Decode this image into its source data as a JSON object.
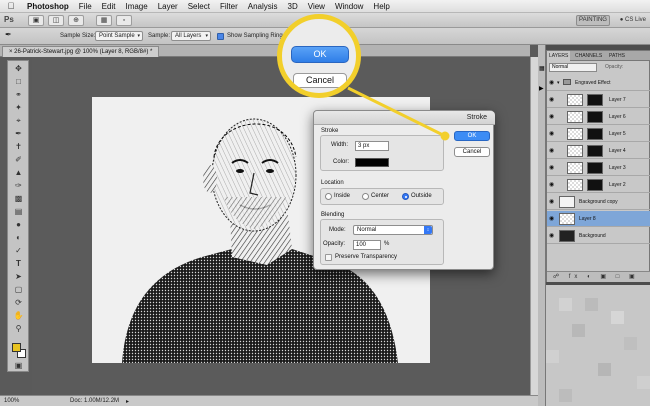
{
  "menubar": {
    "items": [
      "Photoshop",
      "File",
      "Edit",
      "Image",
      "Layer",
      "Select",
      "Filter",
      "Analysis",
      "3D",
      "View",
      "Window",
      "Help"
    ]
  },
  "appbar": {
    "logo": "Ps",
    "workspace": "PAINTING",
    "cs_live": "CS Live"
  },
  "options": {
    "sample_size_label": "Sample Size:",
    "sample_size_value": "Point Sample",
    "sample_label": "Sample:",
    "sample_value": "All Layers",
    "show_ring_label": "Show Sampling Ring"
  },
  "document": {
    "tab_title": "26-Patrick-Stewart.jpg @ 100% (Layer 8, RGB/8#) *",
    "zoom": "100%",
    "doc_size": "Doc: 1.00M/12.2M"
  },
  "colors": {
    "foreground": "#e8c320",
    "accent": "#3c8cf5",
    "callout": "#f2cf2b"
  },
  "layers_panel": {
    "tabs": [
      "LAYERS",
      "CHANNELS",
      "PATHS"
    ],
    "blend_mode": "Normal",
    "opacity_label": "Opacity:",
    "group_name": "Engraved Effect",
    "layers": [
      {
        "name": "Layer 7"
      },
      {
        "name": "Layer 6"
      },
      {
        "name": "Layer 5"
      },
      {
        "name": "Layer 4"
      },
      {
        "name": "Layer 3"
      },
      {
        "name": "Layer 2"
      },
      {
        "name": "Background copy"
      },
      {
        "name": "Layer 8"
      },
      {
        "name": "Background"
      }
    ]
  },
  "stroke_dialog": {
    "title": "Stroke",
    "stroke_group": "Stroke",
    "width_label": "Width:",
    "width_value": "3 px",
    "color_label": "Color:",
    "color_value": "#000000",
    "location_group": "Location",
    "location_options": [
      "Inside",
      "Center",
      "Outside"
    ],
    "location_selected": "Outside",
    "blending_group": "Blending",
    "mode_label": "Mode:",
    "mode_value": "Normal",
    "opacity_label": "Opacity:",
    "opacity_value": "100",
    "opacity_unit": "%",
    "preserve_label": "Preserve Transparency",
    "preserve_checked": false,
    "ok_label": "OK",
    "cancel_label": "Cancel"
  },
  "callout": {
    "ok_label": "OK",
    "cancel_label": "Cancel"
  }
}
